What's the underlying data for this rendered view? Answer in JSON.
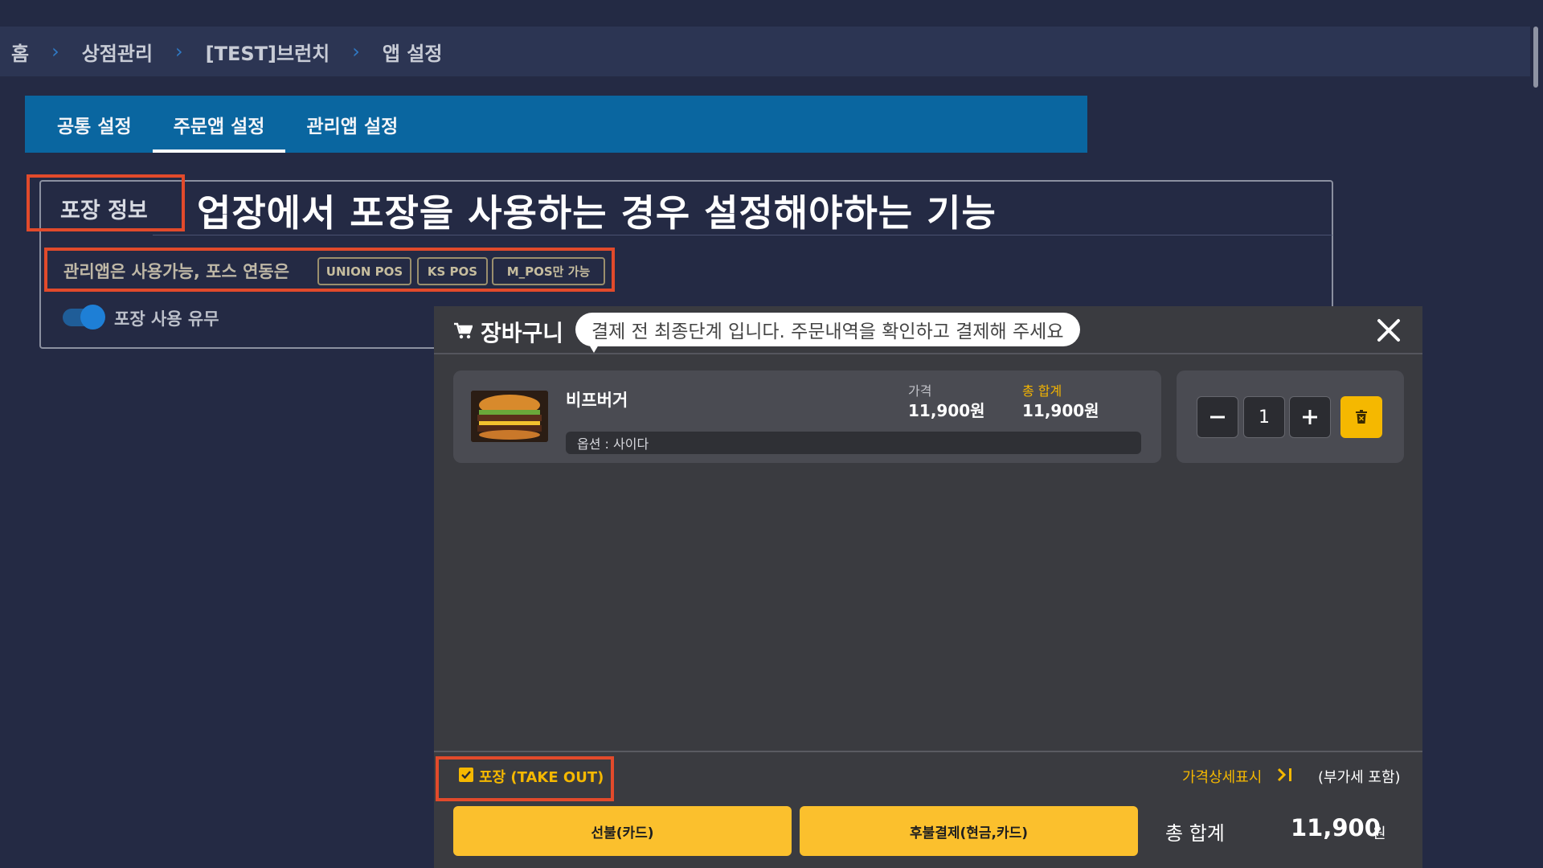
{
  "breadcrumb": {
    "items": [
      "홈",
      "상점관리",
      "[TEST]브런치",
      "앱 설정"
    ]
  },
  "tabs": [
    {
      "label": "공통 설정",
      "active": false
    },
    {
      "label": "주문앱 설정",
      "active": true
    },
    {
      "label": "관리앱 설정",
      "active": false
    }
  ],
  "section": {
    "title": "포장 정보",
    "caption": "업장에서 포장을 사용하는 경우 설정해야하는 기능",
    "notice": "관리앱은 사용가능, 포스 연동은",
    "pos_tags": [
      "UNION POS",
      "KS POS",
      "M_POS만 가능"
    ],
    "toggle_label": "포장 사용 유무",
    "toggle_on": true
  },
  "cart": {
    "title": "장바구니",
    "tooltip": "결제 전 최종단계 입니다. 주문내역을 확인하고 결제해 주세요",
    "item": {
      "name": "비프버거",
      "price_label": "가격",
      "price": "11,900원",
      "total_label": "총 합계",
      "total": "11,900원",
      "option": "옵션 : 사이다",
      "quantity": "1"
    },
    "takeout_label": "포장 (TAKE OUT)",
    "takeout_checked": true,
    "price_detail_label": "가격상세표시",
    "vat_note": "(부가세 포함)",
    "prepay_label": "선불(카드)",
    "postpay_label": "후불결제(현금,카드)",
    "sum_label": "총 합계",
    "sum_value": "11,900",
    "sum_unit": "원"
  },
  "colors": {
    "accent": "#fbc02d",
    "highlight_border": "#e24a2b",
    "tab_bar": "#0a66a0"
  }
}
